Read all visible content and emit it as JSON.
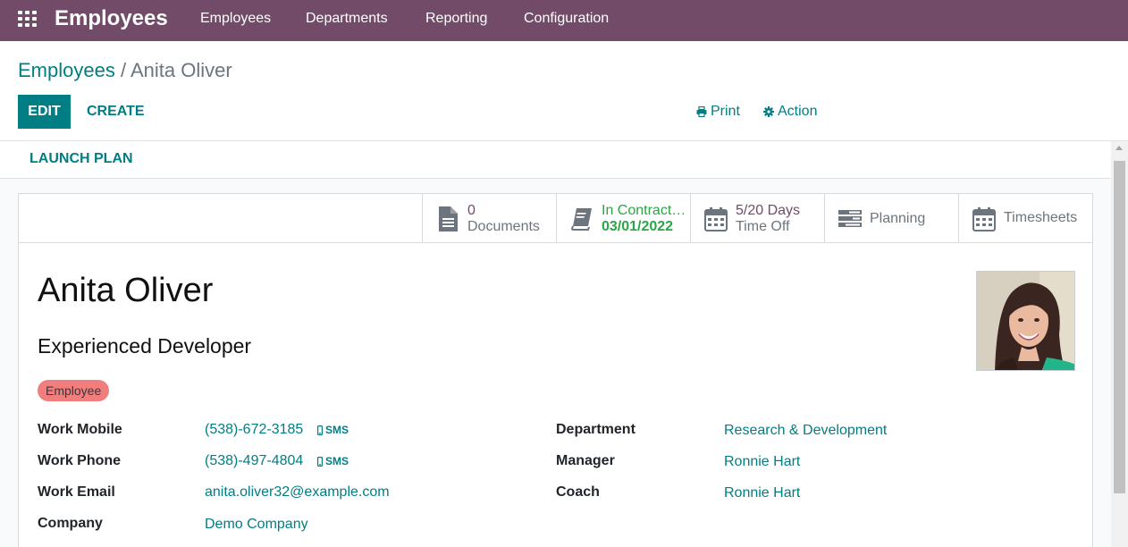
{
  "navbar": {
    "apps_icon": "apps-grid-icon",
    "brand": "Employees",
    "menu": [
      "Employees",
      "Departments",
      "Reporting",
      "Configuration"
    ]
  },
  "breadcrumb": {
    "parent": "Employees",
    "separator": "/",
    "current": "Anita Oliver"
  },
  "toolbar": {
    "edit_label": "EDIT",
    "create_label": "CREATE",
    "print_label": "Print",
    "print_icon": "printer-icon",
    "action_label": "Action",
    "action_icon": "gear-icon"
  },
  "statusbar": {
    "launch_plan_label": "LAUNCH PLAN"
  },
  "smart_buttons": [
    {
      "icon": "document-icon",
      "value": "0",
      "label": "Documents"
    },
    {
      "icon": "book-icon",
      "value": "In Contract…",
      "label": "03/01/2022"
    },
    {
      "icon": "calendar-icon",
      "value": "5/20 Days",
      "label": "Time Off"
    },
    {
      "icon": "tasks-icon",
      "value": "",
      "label": "Planning"
    },
    {
      "icon": "calendar-icon",
      "value": "",
      "label": "Timesheets"
    }
  ],
  "employee": {
    "name": "Anita Oliver",
    "job_title": "Experienced Developer",
    "tag": "Employee"
  },
  "fields_left": [
    {
      "label": "Work Mobile",
      "value": "(538)-672-3185",
      "sms": "SMS"
    },
    {
      "label": "Work Phone",
      "value": "(538)-497-4804",
      "sms": "SMS"
    },
    {
      "label": "Work Email",
      "value": "anita.oliver32@example.com"
    },
    {
      "label": "Company",
      "value": "Demo Company"
    }
  ],
  "fields_right": [
    {
      "label": "Department",
      "value": "Research & Development"
    },
    {
      "label": "Manager",
      "value": "Ronnie Hart"
    },
    {
      "label": "Coach",
      "value": "Ronnie Hart"
    }
  ],
  "colors": {
    "brand": "#714B67",
    "accent": "#017E84",
    "success": "#28a745",
    "tag": "#F06F6F"
  }
}
